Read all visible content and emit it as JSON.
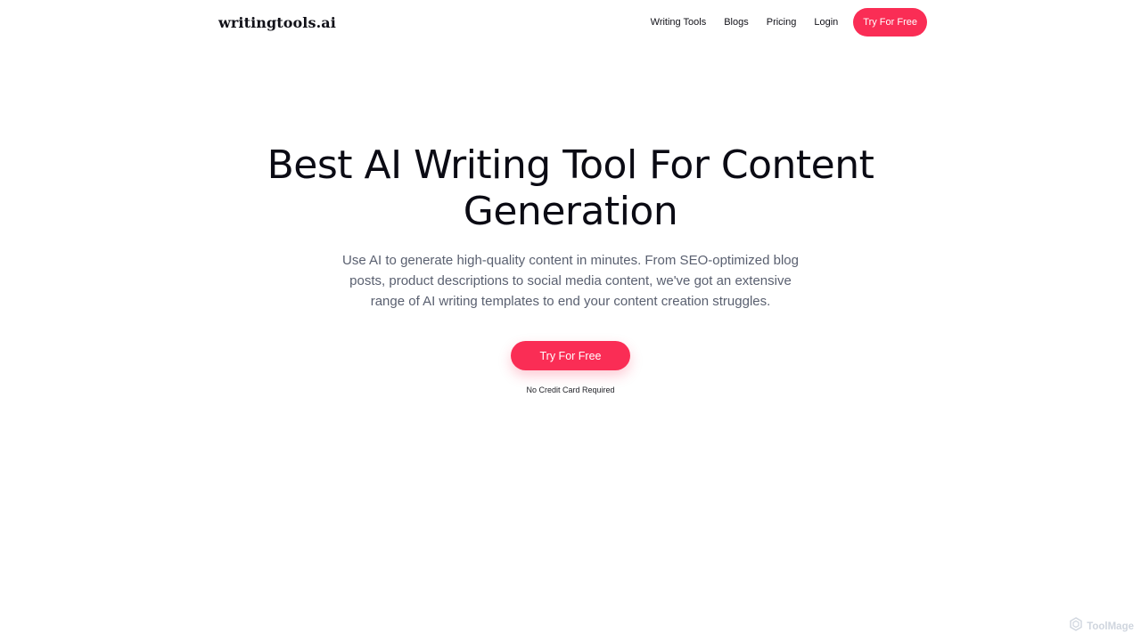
{
  "header": {
    "logo": "writingtools.ai",
    "nav": [
      {
        "label": "Writing Tools"
      },
      {
        "label": "Blogs"
      },
      {
        "label": "Pricing"
      },
      {
        "label": "Login"
      }
    ],
    "cta_label": "Try For Free"
  },
  "hero": {
    "title": "Best AI Writing Tool For Content Generation",
    "subtitle": "Use AI to generate high-quality content in minutes. From SEO-optimized blog posts, product descriptions to social media content, we've got an extensive range of AI writing templates to end your content creation struggles.",
    "cta_label": "Try For Free",
    "note": "No Credit Card Required"
  },
  "watermark": {
    "icon": "toolmage-logo-icon",
    "text": "ToolMage"
  },
  "colors": {
    "accent": "#fa2d55",
    "text": "#0b0b14",
    "muted": "#5a6070",
    "background": "#ffffff"
  }
}
